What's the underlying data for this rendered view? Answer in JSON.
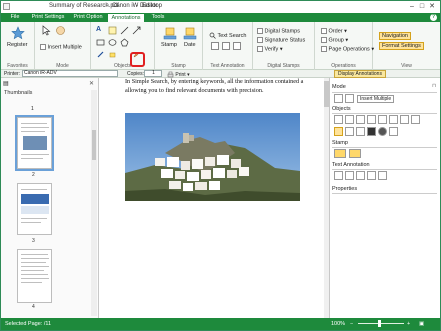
{
  "window": {
    "title_file": "Summary of Research.pdf",
    "title_dash": "-",
    "title_app": "Canon iW Desktop",
    "title_sep": "-",
    "title_mode": "Editor"
  },
  "tabs": [
    {
      "label": "File"
    },
    {
      "label": "Print Settings"
    },
    {
      "label": "Print Option"
    },
    {
      "label": "Annotations"
    },
    {
      "label": "Tools"
    }
  ],
  "help_label": "?",
  "ribbon": {
    "favorites": {
      "register_label": "Register",
      "group_label": "Favorites"
    },
    "mode": {
      "insert_multiple_label": "Insert Multiple",
      "group_label": "Mode"
    },
    "objects": {
      "text_label": "A",
      "group_label": "Objects"
    },
    "stamp": {
      "stamp_label": "Stamp",
      "date_label": "Date",
      "group_label": "Stamp"
    },
    "text_annotation": {
      "text_search_label": "Text Search",
      "group_label": "Text Annotation"
    },
    "digital_stamps": {
      "digital_stamps_label": "Digital Stamps",
      "signature_status_label": "Signature Status",
      "verify_label": "Verify",
      "group_label": "Digital Stamps"
    },
    "operations": {
      "order_label": "Order",
      "group_label_btn": "Group",
      "page_operations_label": "Page Operations",
      "group_label": "Operations"
    },
    "view": {
      "navigation_label": "Navigation",
      "format_settings_label": "Format Settings",
      "group_label": "View"
    }
  },
  "toolbar": {
    "printer_label": "Printer:",
    "printer_value": "Canon iR-ADV",
    "copies_label": "Copies:",
    "copies_value": "1",
    "print_label": "Print",
    "display_annotations_label": "Display Annotations"
  },
  "thumbnails": {
    "header": "Thumbnails",
    "top_page_label": "1",
    "pages": [
      {
        "num": "2"
      },
      {
        "num": "3"
      },
      {
        "num": "4"
      }
    ]
  },
  "document": {
    "line1": "In Simple Search, by entering keywords, all the information contained a",
    "line2": "allowing you to find relevant documents with precision."
  },
  "panel": {
    "mode_label": "Mode",
    "insert_multiple_label": "Insert Multiple",
    "objects_label": "Objects",
    "stamp_label": "Stamp",
    "text_annotation_label": "Text Annotation",
    "properties_label": "Properties"
  },
  "status": {
    "selected_page": "Selected Page: /11",
    "zoom": "100%",
    "zoom_minus": "−",
    "zoom_plus": "+"
  },
  "colors": {
    "ribbon_green": "#1e8a3c",
    "highlight_red": "#e02020",
    "selected_tool": "#ffe39a"
  }
}
